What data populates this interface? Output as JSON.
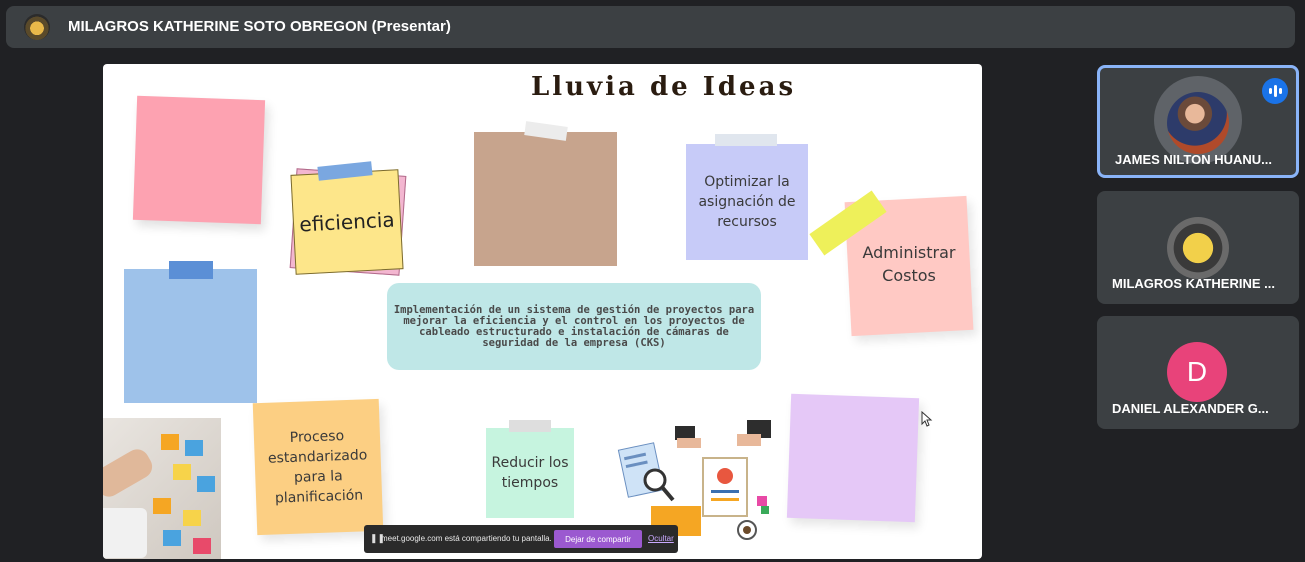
{
  "header": {
    "presenter": "MILAGROS KATHERINE SOTO OBREGON (Presentar)",
    "avatar_icon": "presenter-avatar"
  },
  "slide": {
    "title": "Lluvia de Ideas",
    "notes": {
      "eficiencia": "eficiencia",
      "optimizar": "Optimizar la asignación de recursos",
      "administrar": "Administrar Costos",
      "proceso": "Proceso estandarizado para la planificación",
      "reducir": "Reducir los tiempos"
    },
    "center_text": "Implementación de un sistema de gestión de proyectos para mejorar la eficiencia y el control en los proyectos de cableado estructurado e instalación de cámaras de seguridad de la empresa (CKS)",
    "colors": {
      "pink": "#fda2b1",
      "yellow": "#fde68a",
      "brown": "#c7a48d",
      "lavender": "#c7cbf8",
      "salmon": "#ffc9c4",
      "blue": "#9ec2ea",
      "teal": "#bfe7e7",
      "orange": "#fccf83",
      "mint": "#c6f4df",
      "purple": "#e5c8f7"
    }
  },
  "share_bar": {
    "message": "meet.google.com está compartiendo tu pantalla.",
    "stop_label": "Dejar de compartir",
    "hide_label": "Ocultar"
  },
  "participants": [
    {
      "name": "JAMES NILTON HUANU...",
      "speaking": true
    },
    {
      "name": "MILAGROS KATHERINE ...",
      "speaking": false
    },
    {
      "name": "DANIEL ALEXANDER G...",
      "initial": "D",
      "avatar_color": "#e8437a"
    }
  ],
  "accent": "#8ab4f8"
}
